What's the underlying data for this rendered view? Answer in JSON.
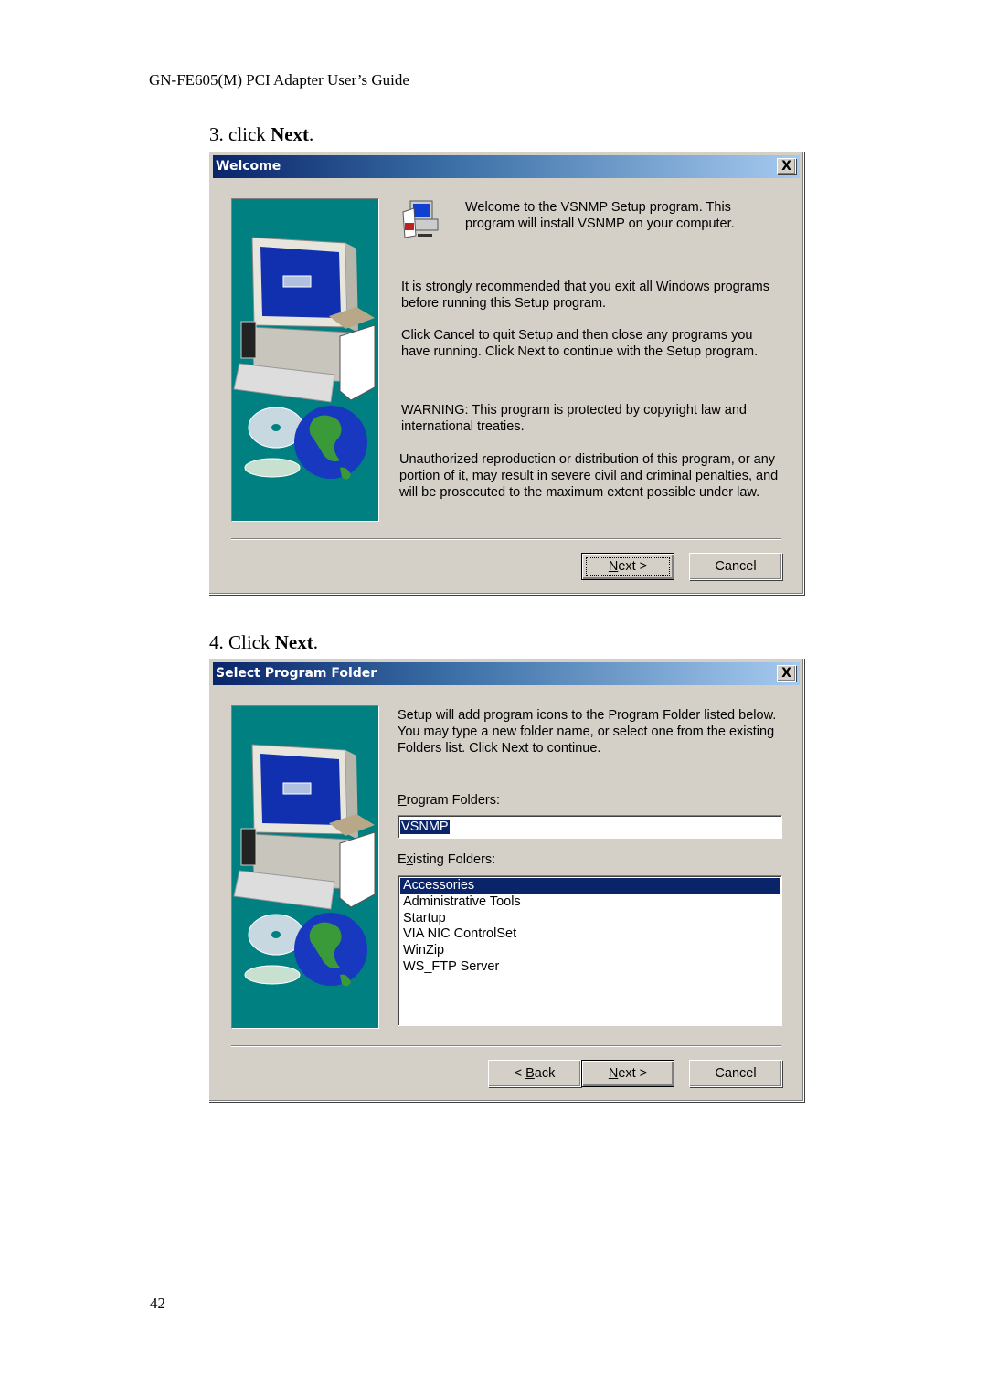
{
  "document": {
    "header": "GN-FE605(M) PCI Adapter User’s Guide",
    "page_number": "42"
  },
  "steps": [
    {
      "prefix": "3. click ",
      "bold": "Next",
      "suffix": "."
    },
    {
      "prefix": "4. Click ",
      "bold": "Next",
      "suffix": "."
    }
  ],
  "welcome_dialog": {
    "title": "Welcome",
    "close_glyph": "X",
    "intro_text_1": "Welcome to the VSNMP Setup program.  This",
    "intro_text_2": "program will install VSNMP on your computer.",
    "para1_line1": "It is strongly recommended that you exit all Windows programs",
    "para1_line2": "before running this Setup program.",
    "para2_line1": "Click Cancel to quit Setup and then close any programs you",
    "para2_line2": "have running.  Click Next to continue with the Setup program.",
    "para3_line1": "WARNING: This program is protected by copyright law and",
    "para3_line2": "international treaties.",
    "para4_line1": "Unauthorized reproduction or distribution of this program, or any",
    "para4_line2": "portion of it, may result in severe civil and criminal penalties, and",
    "para4_line3": "will be prosecuted to the maximum extent possible under law.",
    "next_button": {
      "mnemonic": "N",
      "rest": "ext >"
    },
    "cancel_button": "Cancel"
  },
  "folder_dialog": {
    "title": "Select Program Folder",
    "close_glyph": "X",
    "desc_line1": "Setup will add program icons to the Program Folder listed below.",
    "desc_line2": "You may type a new folder name, or select one from the existing",
    "desc_line3": "Folders list.  Click Next to continue.",
    "program_folders_label": {
      "mnemonic": "P",
      "rest": "rogram Folders:"
    },
    "program_folder_value": "VSNMP",
    "existing_folders_label": {
      "pre": "E",
      "mnemonic": "x",
      "rest": "isting Folders:"
    },
    "existing_folders": [
      {
        "label": "Accessories",
        "selected": true
      },
      {
        "label": "Administrative Tools",
        "selected": false
      },
      {
        "label": "Startup",
        "selected": false
      },
      {
        "label": "VIA NIC ControlSet",
        "selected": false
      },
      {
        "label": "WinZip",
        "selected": false
      },
      {
        "label": "WS_FTP Server",
        "selected": false
      }
    ],
    "back_button": {
      "pre": "< ",
      "mnemonic": "B",
      "rest": "ack"
    },
    "next_button": {
      "mnemonic": "N",
      "rest": "ext >"
    },
    "cancel_button": "Cancel"
  },
  "colors": {
    "dialog_face": "#d4d0c8",
    "title_start": "#0a246a",
    "title_end": "#a6caf0",
    "art_background": "#008080",
    "selection": "#0a246a"
  }
}
